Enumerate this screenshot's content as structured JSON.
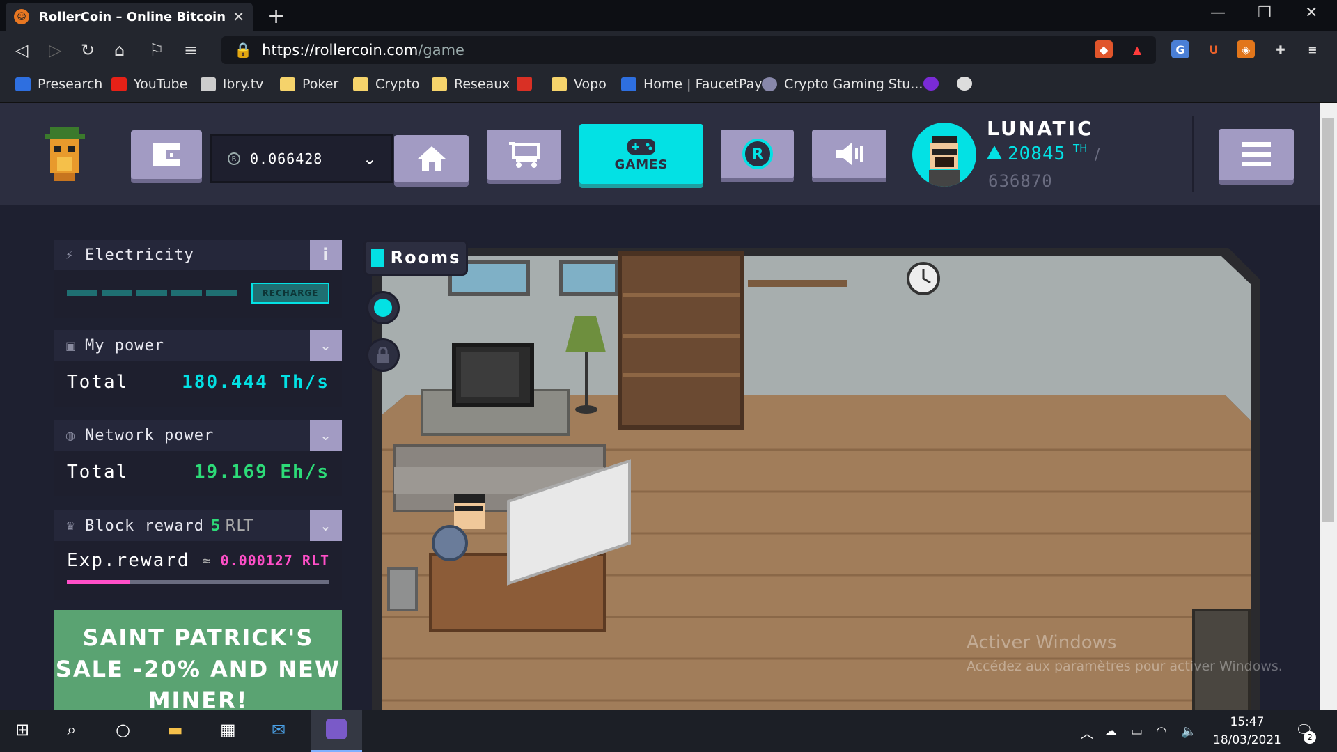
{
  "browser": {
    "tab_title": "RollerCoin – Online Bitcoin Mining",
    "url_scheme": "https://",
    "url_host": "rollercoin.com",
    "url_path": "/game",
    "bookmarks": [
      {
        "label": "Presearch",
        "icon": "presearch-icon"
      },
      {
        "label": "YouTube",
        "icon": "youtube-icon"
      },
      {
        "label": "lbry.tv",
        "icon": "lbry-icon"
      },
      {
        "label": "Poker",
        "icon": "folder-icon"
      },
      {
        "label": "Crypto",
        "icon": "folder-icon"
      },
      {
        "label": "Reseaux",
        "icon": "folder-icon"
      },
      {
        "label": "",
        "icon": "gmail-icon"
      },
      {
        "label": "Vopo",
        "icon": "folder-icon"
      },
      {
        "label": "Home | FaucetPay",
        "icon": "faucetpay-icon"
      },
      {
        "label": "Crypto Gaming Stu...",
        "icon": "crypto-gaming-icon"
      }
    ]
  },
  "header": {
    "balance": "0.066428",
    "games_label": "GAMES",
    "user": {
      "name": "LUNATIC",
      "power": "20845",
      "power_unit": "TH",
      "total": "636870"
    }
  },
  "panels": {
    "electricity": {
      "title": "Electricity",
      "recharge": "RECHARGE"
    },
    "my_power": {
      "title": "My power",
      "label": "Total",
      "value": "180.444 Th/s"
    },
    "network_power": {
      "title": "Network power",
      "label": "Total",
      "value": "19.169 Eh/s"
    },
    "block_reward": {
      "title": "Block reward",
      "amount": "5",
      "currency": "RLT",
      "exp_label": "Exp.reward",
      "approx": "≈",
      "exp_value": "0.000127 RLT",
      "progress": 0.24
    }
  },
  "promo": {
    "line1": "SAINT PATRICK'S",
    "line2": "SALE -20% AND NEW",
    "line3": "MINER!"
  },
  "room": {
    "rooms_label": "Rooms"
  },
  "watermark": {
    "title": "Activer Windows",
    "subtitle": "Accédez aux paramètres pour activer Windows."
  },
  "taskbar": {
    "time": "15:47",
    "date": "18/03/2021",
    "notif_count": "2"
  },
  "colors": {
    "accent": "#03e1e4",
    "button": "#a29bc3",
    "panel": "#1e1f2e",
    "green": "#2ddb78",
    "pink": "#ff4fc8"
  }
}
